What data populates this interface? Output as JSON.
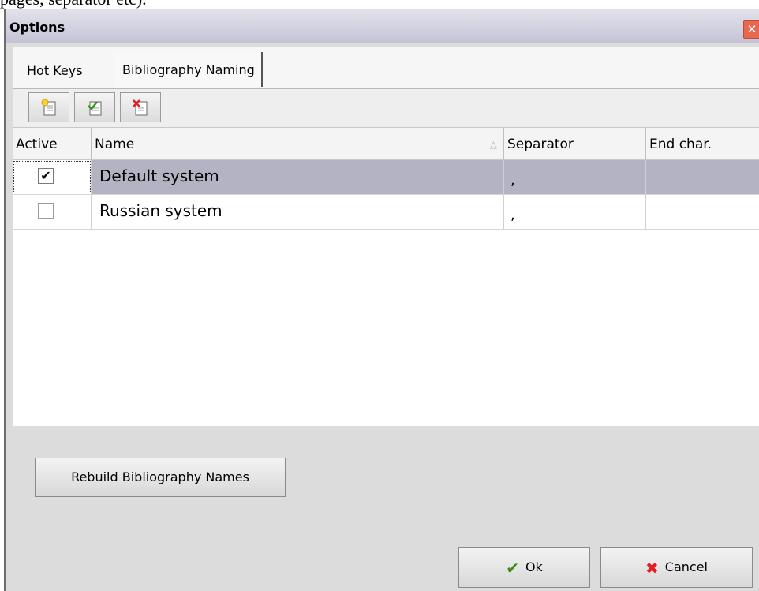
{
  "caption": "pages, separator etc).",
  "window": {
    "title": "Options",
    "close_glyph": "✕"
  },
  "tabs": [
    {
      "label": "Hot Keys",
      "active": false
    },
    {
      "label": "Bibliography Naming",
      "active": true
    }
  ],
  "toolbar": {
    "buttons": [
      {
        "name": "add-item-button",
        "icon": "new-document-icon"
      },
      {
        "name": "edit-item-button",
        "icon": "checked-document-icon"
      },
      {
        "name": "delete-item-button",
        "icon": "delete-document-icon"
      }
    ]
  },
  "grid": {
    "columns": [
      "Active",
      "Name",
      "Separator",
      "End char."
    ],
    "sort_glyph": "△",
    "rows": [
      {
        "active": true,
        "name": "Default system",
        "separator": ",",
        "end_char": "",
        "selected": true
      },
      {
        "active": false,
        "name": "Russian system",
        "separator": ",",
        "end_char": "",
        "selected": false
      }
    ]
  },
  "buttons": {
    "rebuild": "Rebuild Bibliography Names",
    "ok": "Ok",
    "cancel": "Cancel"
  },
  "colors": {
    "selected_row": "#b3b3c4",
    "dialog_bg": "#dcdcdc",
    "titlebar": "#c4c4d6",
    "close_button": "#e8684f",
    "ok_icon": "#3c8a14",
    "cancel_icon": "#e02020"
  }
}
